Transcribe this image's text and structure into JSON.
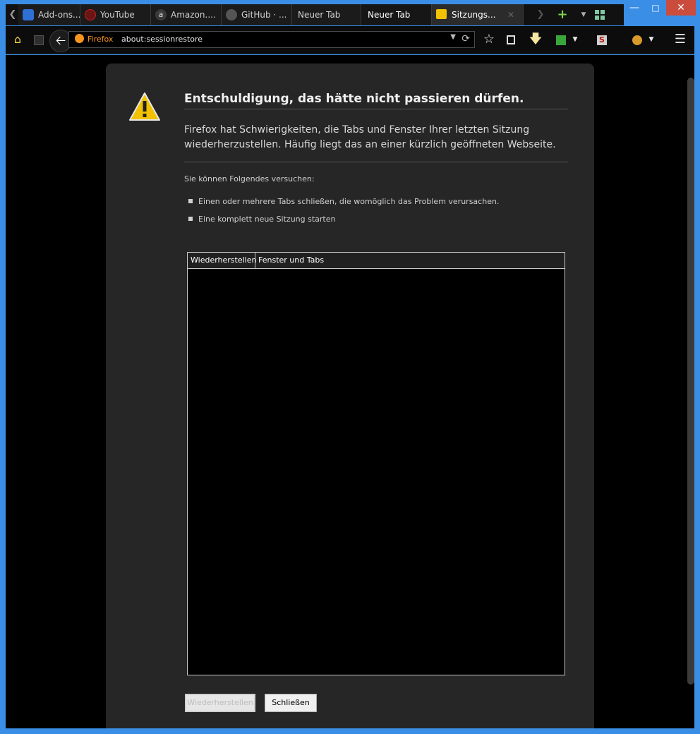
{
  "tabs": [
    {
      "label": "Add-ons...",
      "icon": "puzzle-icon",
      "color": "#2f6fd6"
    },
    {
      "label": "YouTube",
      "icon": "youtube-icon",
      "color": "#cc2020"
    },
    {
      "label": "Amazon....",
      "icon": "amazon-icon",
      "color": "#6a6a6a"
    },
    {
      "label": "GitHub · ...",
      "icon": "github-icon",
      "color": "#555555"
    },
    {
      "label": "Neuer Tab",
      "icon": "",
      "color": ""
    },
    {
      "label": "Neuer Tab",
      "icon": "",
      "color": ""
    },
    {
      "label": "Sitzungs...",
      "icon": "warning-icon",
      "color": "#f2c200"
    }
  ],
  "toolbar": {
    "identity_label": "Firefox",
    "url": "about:sessionrestore"
  },
  "page": {
    "title": "Entschuldigung, das hätte nicht passieren dürfen.",
    "lead": "Firefox hat Schwierigkeiten, die Tabs und Fenster Ihrer letzten Sitzung wiederherzustellen. Häufig liegt das an einer kürzlich geöffneten Webseite.",
    "try_hint": "Sie können Folgendes versuchen:",
    "suggestions": [
      "Einen oder mehrere Tabs schließen, die womöglich das Problem verursachen.",
      "Eine komplett neue Sitzung starten"
    ],
    "tree_columns": [
      "Wiederherstellen",
      "Fenster und Tabs"
    ],
    "restore_button": "Wiederherstellen",
    "close_button": "Schließen"
  },
  "colors": {
    "window_frame": "#3a8ee6",
    "close_button": "#c94c3c",
    "accent_orange": "#f7941e",
    "warning_yellow": "#f2c200"
  }
}
